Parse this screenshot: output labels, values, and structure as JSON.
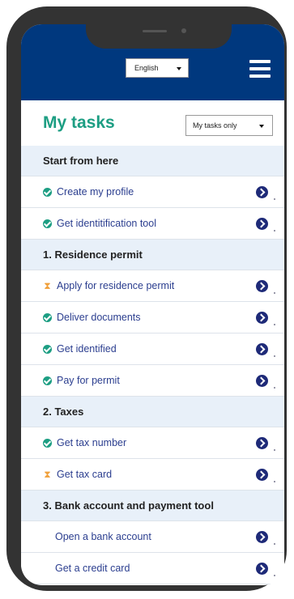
{
  "header": {
    "language": "English",
    "menu_icon": "hamburger-menu-icon"
  },
  "title": "My tasks",
  "filter": "My tasks only",
  "sections": [
    {
      "title": "Start from here",
      "tasks": [
        {
          "label": "Create my profile",
          "status": "done"
        },
        {
          "label": "Get identitification tool",
          "status": "done"
        }
      ]
    },
    {
      "title": "1. Residence permit",
      "tasks": [
        {
          "label": "Apply for residence permit",
          "status": "pending"
        },
        {
          "label": "Deliver documents",
          "status": "done"
        },
        {
          "label": "Get identified",
          "status": "done"
        },
        {
          "label": "Pay for permit",
          "status": "done"
        }
      ]
    },
    {
      "title": "2. Taxes",
      "tasks": [
        {
          "label": "Get tax number",
          "status": "done"
        },
        {
          "label": "Get tax card",
          "status": "pending"
        }
      ]
    },
    {
      "title": "3. Bank account and payment tool",
      "tasks": [
        {
          "label": "Open a bank account",
          "status": "none"
        },
        {
          "label": "Get a credit card",
          "status": "none"
        }
      ]
    }
  ],
  "colors": {
    "header_bg": "#00387e",
    "title": "#1d9e83",
    "done": "#1d9e83",
    "pending": "#f0a03a",
    "link": "#2b3e8f",
    "section_bg": "#e8f0f9"
  }
}
